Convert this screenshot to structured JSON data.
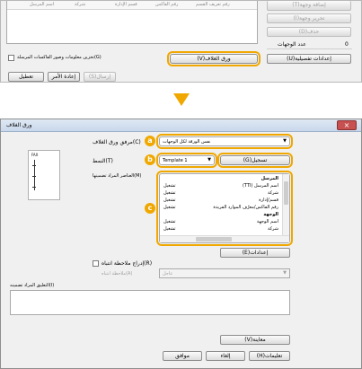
{
  "top": {
    "columns": [
      "رقم تعريف القسم",
      "رقم الفاكس",
      "قسم الإدارة",
      "شركة",
      "اسم المرسل"
    ],
    "side_buttons": [
      "(T)إضافة وجهة",
      "(I)تحرير وجهة",
      "(D)حذف"
    ],
    "dest_count_label": "عدد الوجهات",
    "dest_count_value": "0",
    "details_button": "(U)إعدادات تفصيلية",
    "cover_sheet_button": "(V)ورق الغلاف",
    "store_checkbox_label": "(G)تخزين معلومات وصور الفاكسات المرسلة",
    "send_button": "(S)إرسال",
    "reset_button": "إعادة الأمر",
    "cancel_button": "تعطيل"
  },
  "arrow_color": "#f0a800",
  "dialog": {
    "title": "ورق الغلاف",
    "close_symbol": "×",
    "cover_usage_label": "(C)مرفق ورق الغلاف",
    "cover_usage_value": "نفس الورقة لكل الوجهات",
    "style_label": "(T)النمط",
    "style_value": "Template 1",
    "register_button": "(G)تسجيل",
    "items_label": "(M)العناصر المراد تضمينها",
    "preview_text": "FAX",
    "items": [
      {
        "name": "المرسل",
        "value": "",
        "bold": true
      },
      {
        "name": "اسم المرسل (TTI)",
        "value": "تشغيل",
        "bold": false
      },
      {
        "name": "شركة",
        "value": "تشغيل",
        "bold": false
      },
      {
        "name": "قسم/إدارة",
        "value": "تشغيل",
        "bold": false
      },
      {
        "name": "رقم الفاكس/معرّف الموارد الفريدة",
        "value": "تشغيل",
        "bold": false
      },
      {
        "name": "الوجهة",
        "value": "",
        "bold": true
      },
      {
        "name": "اسم الوجهة",
        "value": "تشغيل",
        "bold": false
      },
      {
        "name": "شركة",
        "value": "تشغيل",
        "bold": false
      }
    ],
    "settings_button": "(E)إعدادات",
    "include_note_label": "(R)إدراج ملاحظة انتباه",
    "note_attention_label": "(A)ملاحظة انتباه",
    "note_attention_value": "عاجل",
    "include_text_label": "(I)التعليق المراد تضمينه",
    "preview_button": "(V)معاينة",
    "ok_button": "موافق",
    "cancel_button": "إلغاء",
    "help_button": "(H)تعليمات"
  },
  "badges": [
    "a",
    "b",
    "c"
  ]
}
